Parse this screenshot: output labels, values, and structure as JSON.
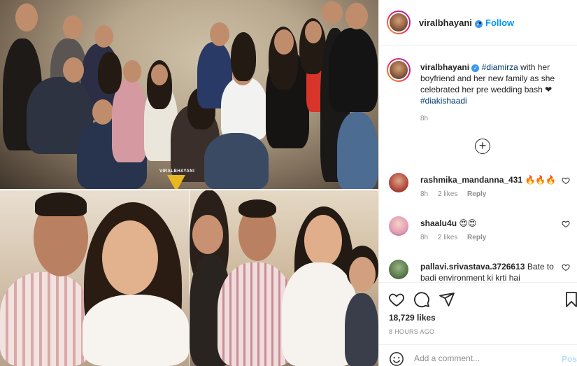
{
  "post": {
    "username": "viralbhayani",
    "follow_label": "Follow",
    "header_separator": "•",
    "watermark": "VIRALBHAYANI",
    "caption": {
      "username": "viralbhayani",
      "tag1": "#diamirza",
      "text1": " with her boyfriend and her new family as she celebrated her pre wedding bash ❤ ",
      "tag2": "#diakishaadi",
      "time": "8h"
    },
    "load_more_label": "+",
    "comments": [
      {
        "username": "rashmika_mandanna_431",
        "text": "🔥🔥🔥",
        "time": "8h",
        "likes": "2 likes",
        "reply": "Reply",
        "avatar_color": "#b5473a"
      },
      {
        "username": "shaalu4u",
        "text": "😍😍",
        "time": "8h",
        "likes": "2 likes",
        "reply": "Reply",
        "avatar_color": "#e39bb5"
      },
      {
        "username": "pallavi.srivastava.3726613",
        "text": "Bate to badi environment ki krti hai",
        "time": "",
        "likes": "",
        "reply": "",
        "avatar_color": "#5a7a4a"
      }
    ],
    "likes_count": "18,729 likes",
    "post_time": "8 HOURS AGO",
    "add_comment_placeholder": "Add a comment...",
    "post_button": "Post"
  },
  "colors": {
    "link": "#0095f6",
    "hashtag": "#00376b",
    "secondary_text": "#8e8e8e",
    "watermark_logo": "#e8b722"
  }
}
